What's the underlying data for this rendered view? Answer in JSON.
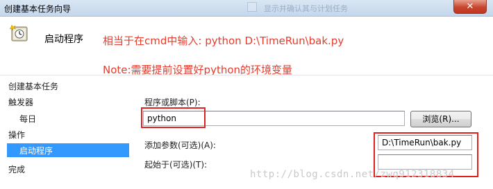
{
  "window": {
    "title": "创建基本任务向导",
    "background_caption": "显示并确认其与计划任务",
    "close_glyph": "✕"
  },
  "header": {
    "page_title": "启动程序",
    "icon": "task-wizard-icon"
  },
  "annotations": {
    "note1": "相当于在cmd中输入: python D:\\TimeRun\\bak.py",
    "note2": "Note:需要提前设置好python的环境变量",
    "color": "#e53c2e"
  },
  "sidebar": {
    "items": [
      {
        "label": "创建基本任务"
      },
      {
        "label": "触发器"
      },
      {
        "label": "每日"
      },
      {
        "label": "操作"
      },
      {
        "label": "启动程序"
      },
      {
        "label": "完成"
      }
    ],
    "selected_color": "#3399ff"
  },
  "form": {
    "program_label": "程序或脚本(P):",
    "program_value": "python",
    "browse_label": "浏览(R)...",
    "args_label": "添加参数(可选)(A):",
    "args_value": "D:\\TimeRun\\bak.py",
    "startin_label": "起始于(可选)(T):",
    "startin_value": ""
  },
  "watermark": "http://blog.csdn.net/zwq912318834"
}
